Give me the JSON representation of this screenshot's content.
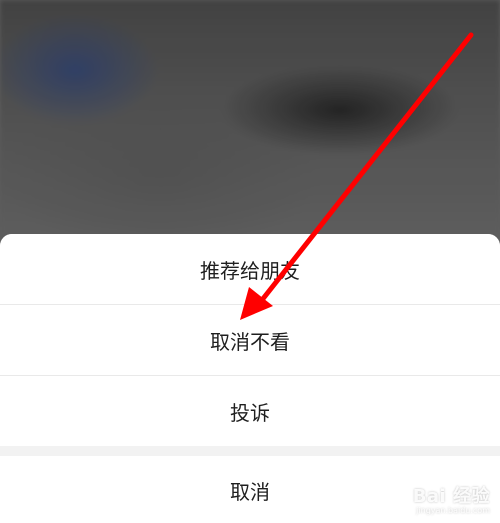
{
  "menu": {
    "items": [
      {
        "label": "推荐给朋友"
      },
      {
        "label": "取消不看"
      },
      {
        "label": "投诉"
      }
    ],
    "cancel_label": "取消"
  },
  "watermark": {
    "main": "Bai 经验",
    "sub": "jingyan.baidu.com"
  },
  "annotation": {
    "arrow_color": "#ff0000"
  }
}
